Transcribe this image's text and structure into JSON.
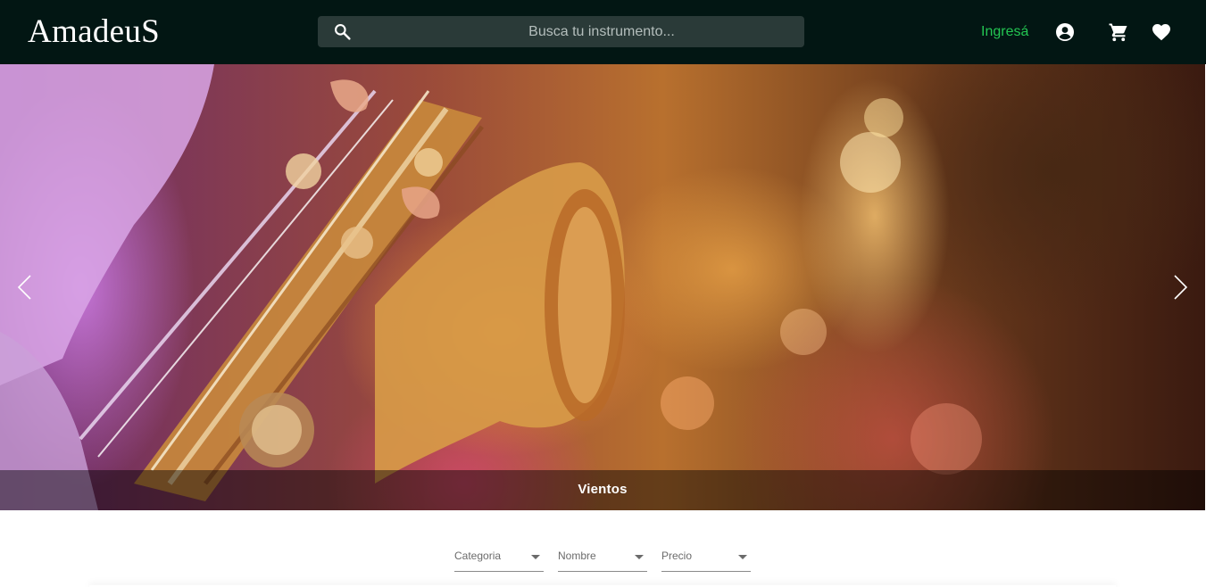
{
  "brand": {
    "name": "AmadeuS"
  },
  "search": {
    "placeholder": "Busca tu instrumento..."
  },
  "header": {
    "login_label": "Ingresá",
    "icons": [
      "account-icon",
      "cart-icon",
      "favorites-icon"
    ]
  },
  "colors": {
    "header_bg": "#021613",
    "accent_green": "#23c552",
    "search_bg": "#2a3a38"
  },
  "carousel": {
    "caption": "Vientos",
    "prev_icon": "chevron-left-icon",
    "next_icon": "chevron-right-icon"
  },
  "filters": [
    {
      "label": "Categoria"
    },
    {
      "label": "Nombre"
    },
    {
      "label": "Precio"
    }
  ]
}
